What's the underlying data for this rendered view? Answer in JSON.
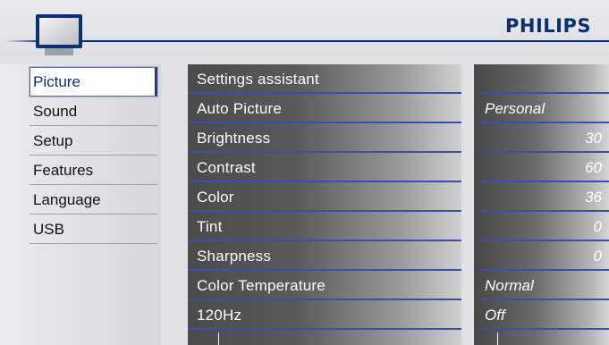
{
  "brand": "PHILIPS",
  "left_menu": {
    "items": [
      {
        "label": "Picture",
        "selected": true
      },
      {
        "label": "Sound",
        "selected": false
      },
      {
        "label": "Setup",
        "selected": false
      },
      {
        "label": "Features",
        "selected": false
      },
      {
        "label": "Language",
        "selected": false
      },
      {
        "label": "USB",
        "selected": false
      }
    ]
  },
  "settings": {
    "rows": [
      {
        "label": "Settings assistant",
        "value": ""
      },
      {
        "label": "Auto Picture",
        "value": "Personal"
      },
      {
        "label": "Brightness",
        "value": "30"
      },
      {
        "label": "Contrast",
        "value": "60"
      },
      {
        "label": "Color",
        "value": "36"
      },
      {
        "label": "Tint",
        "value": "0"
      },
      {
        "label": "Sharpness",
        "value": "0"
      },
      {
        "label": "Color Temperature",
        "value": "Normal"
      },
      {
        "label": "120Hz",
        "value": "Off"
      }
    ]
  },
  "icons": {
    "tv": "tv-icon"
  },
  "colors": {
    "brand": "#0b2f73",
    "row_divider": "#3a4fa8",
    "panel_dark": "#4b4b4b"
  }
}
